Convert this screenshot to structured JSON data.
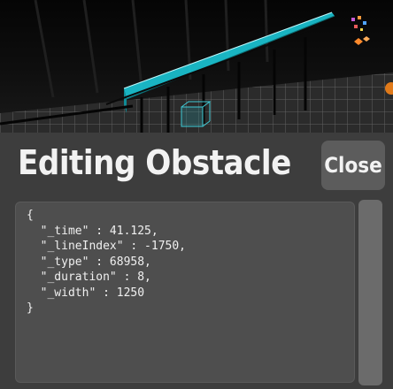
{
  "editor": {
    "title": "Editing Obstacle",
    "close_label": "Close",
    "json_text": "{\n  \"_time\" : 41.125,\n  \"_lineIndex\" : -1750,\n  \"_type\" : 68958,\n  \"_duration\" : 8,\n  \"_width\" : 1250\n}"
  },
  "colors": {
    "panel_background": "#3d3d3d",
    "editor_background": "#4e4e4e",
    "button_background": "#5c5c5c",
    "obstacle_accent": "#22d3e0"
  },
  "icons": {
    "selection_box": "wireframe-cube-icon"
  }
}
